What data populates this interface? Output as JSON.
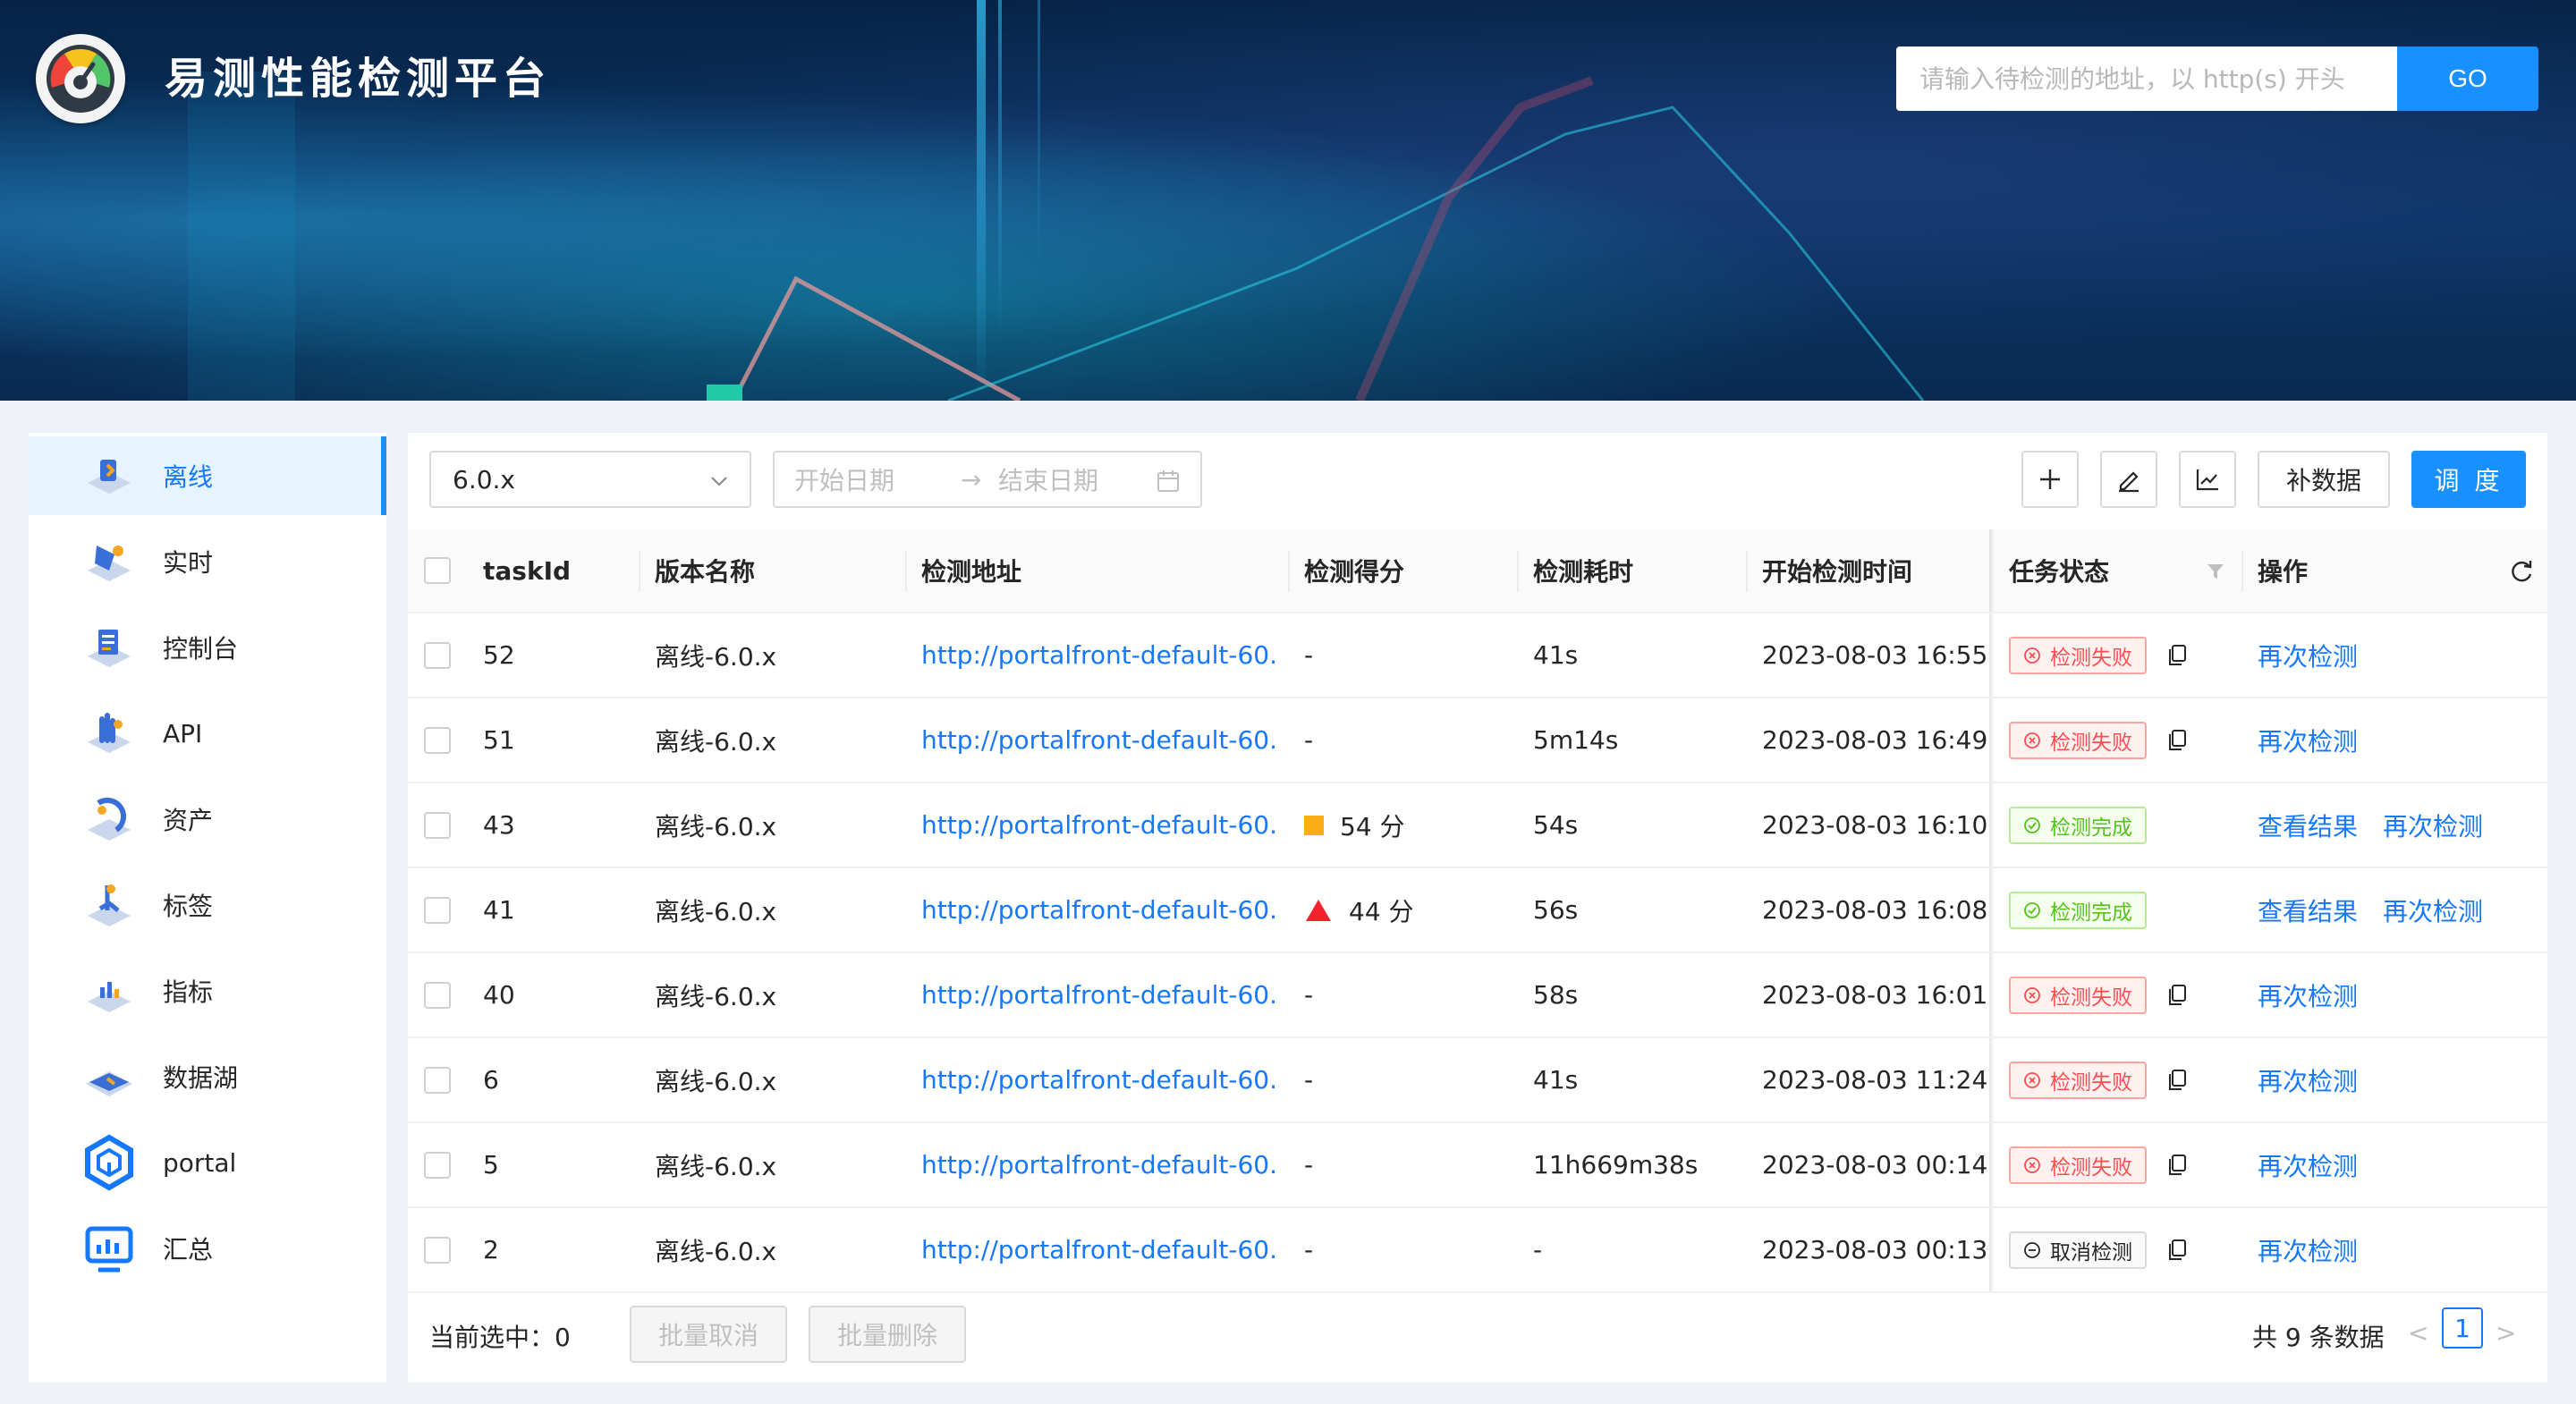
{
  "header": {
    "title": "易测性能检测平台",
    "search_placeholder": "请输入待检测的地址，以 http(s) 开头",
    "go_label": "GO"
  },
  "sidebar": {
    "items": [
      {
        "label": "离线",
        "icon": "offline-icon",
        "active": true
      },
      {
        "label": "实时",
        "icon": "realtime-icon"
      },
      {
        "label": "控制台",
        "icon": "console-icon"
      },
      {
        "label": "API",
        "icon": "api-icon"
      },
      {
        "label": "资产",
        "icon": "assets-icon"
      },
      {
        "label": "标签",
        "icon": "tag-icon"
      },
      {
        "label": "指标",
        "icon": "metrics-icon"
      },
      {
        "label": "数据湖",
        "icon": "data-lake-icon"
      },
      {
        "label": "portal",
        "icon": "portal-icon"
      },
      {
        "label": "汇总",
        "icon": "summary-icon"
      }
    ]
  },
  "toolbar": {
    "version_value": "6.0.x",
    "start_date_placeholder": "开始日期",
    "range_arrow": "→",
    "end_date_placeholder": "结束日期",
    "icons": [
      "plus-icon",
      "edit-icon",
      "line-chart-icon"
    ],
    "supplement_label": "补数据",
    "schedule_label": "调 度"
  },
  "table": {
    "columns": [
      "taskId",
      "版本名称",
      "检测地址",
      "检测得分",
      "检测耗时",
      "开始检测时间",
      "任务状态",
      "操作"
    ],
    "rows": [
      {
        "id": "52",
        "version": "离线-6.0.x",
        "url": "http://portalfront-default-60...",
        "score": "-",
        "duration": "41s",
        "start": "2023-08-03 16:55:",
        "status": "检测失败",
        "status_type": "fail",
        "actions": [
          "再次检测"
        ]
      },
      {
        "id": "51",
        "version": "离线-6.0.x",
        "url": "http://portalfront-default-60...",
        "score": "-",
        "duration": "5m14s",
        "start": "2023-08-03 16:49:",
        "status": "检测失败",
        "status_type": "fail",
        "actions": [
          "再次检测"
        ]
      },
      {
        "id": "43",
        "version": "离线-6.0.x",
        "url": "http://portalfront-default-60...",
        "score": "54 分",
        "score_mark": "square",
        "duration": "54s",
        "start": "2023-08-03 16:10:",
        "status": "检测完成",
        "status_type": "done",
        "actions": [
          "查看结果",
          "再次检测"
        ]
      },
      {
        "id": "41",
        "version": "离线-6.0.x",
        "url": "http://portalfront-default-60...",
        "score": "44 分",
        "score_mark": "triangle",
        "duration": "56s",
        "start": "2023-08-03 16:08:",
        "status": "检测完成",
        "status_type": "done",
        "actions": [
          "查看结果",
          "再次检测"
        ]
      },
      {
        "id": "40",
        "version": "离线-6.0.x",
        "url": "http://portalfront-default-60...",
        "score": "-",
        "duration": "58s",
        "start": "2023-08-03 16:01:",
        "status": "检测失败",
        "status_type": "fail",
        "actions": [
          "再次检测"
        ]
      },
      {
        "id": "6",
        "version": "离线-6.0.x",
        "url": "http://portalfront-default-60...",
        "score": "-",
        "duration": "41s",
        "start": "2023-08-03 11:24:",
        "status": "检测失败",
        "status_type": "fail",
        "actions": [
          "再次检测"
        ]
      },
      {
        "id": "5",
        "version": "离线-6.0.x",
        "url": "http://portalfront-default-60...",
        "score": "-",
        "duration": "11h669m38s",
        "start": "2023-08-03 00:14:",
        "status": "检测失败",
        "status_type": "fail",
        "actions": [
          "再次检测"
        ]
      },
      {
        "id": "2",
        "version": "离线-6.0.x",
        "url": "http://portalfront-default-60...",
        "score": "-",
        "duration": "-",
        "start": "2023-08-03 00:13:",
        "status": "取消检测",
        "status_type": "cancel",
        "actions": [
          "再次检测"
        ]
      }
    ]
  },
  "footer": {
    "selected_text": "当前选中：0",
    "batch_cancel_label": "批量取消",
    "batch_delete_label": "批量删除",
    "total_text": "共 9 条数据",
    "prev": "<",
    "current_page": "1",
    "next": ">"
  },
  "colors": {
    "primary": "#1890ff",
    "link": "#1677ff",
    "fail": "#ff4d4f",
    "done": "#52c41a",
    "score_square": "#faad14",
    "score_triangle": "#f5222d"
  }
}
